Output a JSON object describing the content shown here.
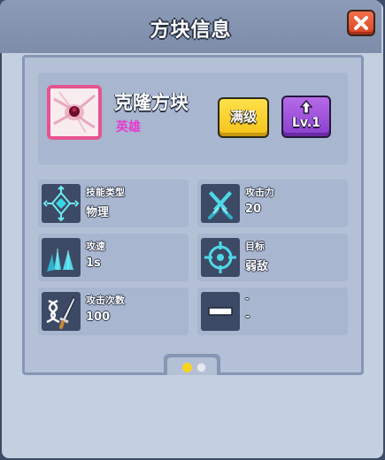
{
  "dialog": {
    "title": "方块信息",
    "close_icon": "close-icon"
  },
  "block": {
    "name": "克隆方块",
    "rarity": "英雄",
    "rarity_color": "#e43ccf",
    "max_label": "满级",
    "level_label": "Lv.1"
  },
  "stats": [
    {
      "label": "技能类型",
      "value": "物理",
      "icon": "diamond-target-icon"
    },
    {
      "label": "攻击力",
      "value": "20",
      "icon": "crossed-swords-icon"
    },
    {
      "label": "攻速",
      "value": "1s",
      "icon": "triple-arrows-icon"
    },
    {
      "label": "目标",
      "value": "弱敌",
      "icon": "crosshair-icon"
    },
    {
      "label": "攻击次数",
      "value": "100",
      "icon": "dna-sword-icon"
    },
    {
      "label": "-",
      "value": "-",
      "icon": "dash-icon"
    }
  ],
  "pagination": {
    "current_page": 1,
    "total_pages": 2
  }
}
